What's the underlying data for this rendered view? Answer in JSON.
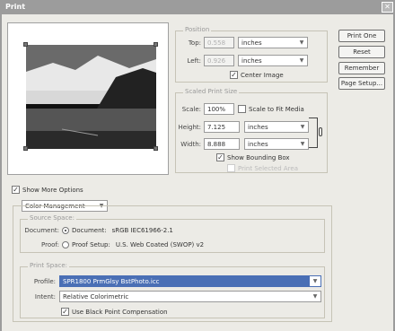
{
  "window": {
    "title": "Print"
  },
  "buttons": {
    "print_one": "Print One",
    "reset": "Reset",
    "remember": "Remember",
    "page_setup": "Page Setup..."
  },
  "position": {
    "title": "Position",
    "top_label": "Top:",
    "top_value": "0.558",
    "top_unit": "inches",
    "left_label": "Left:",
    "left_value": "0.926",
    "left_unit": "inches",
    "center_image_label": "Center Image",
    "center_image_checked": true
  },
  "scaled": {
    "title": "Scaled Print Size",
    "scale_label": "Scale:",
    "scale_value": "100%",
    "scale_to_fit_label": "Scale to Fit Media",
    "height_label": "Height:",
    "height_value": "7.125",
    "height_unit": "inches",
    "width_label": "Width:",
    "width_value": "8.888",
    "width_unit": "inches",
    "show_bounding_box_label": "Show Bounding Box",
    "print_selected_area_label": "Print Selected Area"
  },
  "more_options": {
    "show_more_label": "Show More Options",
    "dropdown_value": "Color Management"
  },
  "source": {
    "title": "Source Space:",
    "document_label": "Document:",
    "document_option": "Document:",
    "document_value": "sRGB IEC61966-2.1",
    "proof_label": "Proof:",
    "proof_option": "Proof Setup:",
    "proof_value": "U.S. Web Coated (SWOP) v2"
  },
  "print_space": {
    "title": "Print Space:",
    "profile_label": "Profile:",
    "profile_value": "SPR1800 PrmGlsy BstPhoto.icc",
    "intent_label": "Intent:",
    "intent_value": "Relative Colorimetric",
    "black_point_label": "Use Black Point Compensation"
  },
  "colors": {
    "highlight": "#4a6fb5",
    "title_bar": "#9c9c9c"
  }
}
